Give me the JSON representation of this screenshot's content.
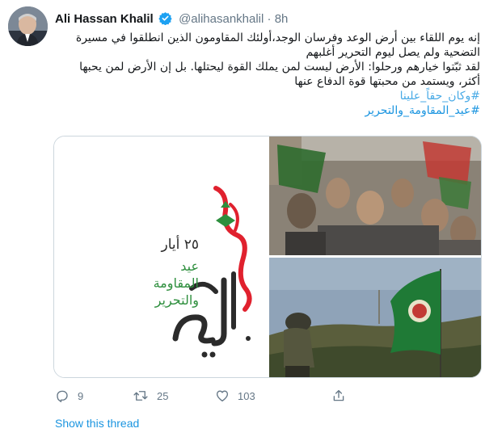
{
  "author": {
    "name": "Ali Hassan Khalil",
    "handle": "@alihasankhalil",
    "separator": "·",
    "time": "8h"
  },
  "tweet": {
    "lines": [
      "إنه يوم اللقاء بين أرض الوعد وفرسان الوجد،أولئك المقاومون الذين انطلقوا في مسيرة",
      "التضحية ولم يصل ليوم التحرير أغلبهم",
      "لقد ثبّتوا خيارهم ورحلوا: الأرض ليست لمن يملك القوة ليحتلها. بل إن الأرض لمن يحبها",
      "أكثر، ويستمد من محبتها قوة الدفاع عنها"
    ],
    "hashtags": [
      "#وكان_حقاً_علينا",
      "#عيد_المقاومة_والتحرير"
    ]
  },
  "poster": {
    "date": "٢٥ أيار",
    "title_lines": [
      "عيد",
      "المقاومة",
      "والتحرير"
    ],
    "calligraphy": "وكان حقاً علينا"
  },
  "actions": {
    "replies": "9",
    "retweets": "25",
    "likes": "103"
  },
  "show_thread": "Show this thread",
  "colors": {
    "link": "#1b95e0",
    "muted": "#657786",
    "poster_green": "#2e8f3e",
    "poster_red": "#e0212e"
  },
  "icons": [
    "verified-badge-icon",
    "reply-icon",
    "retweet-icon",
    "like-icon",
    "share-icon"
  ]
}
